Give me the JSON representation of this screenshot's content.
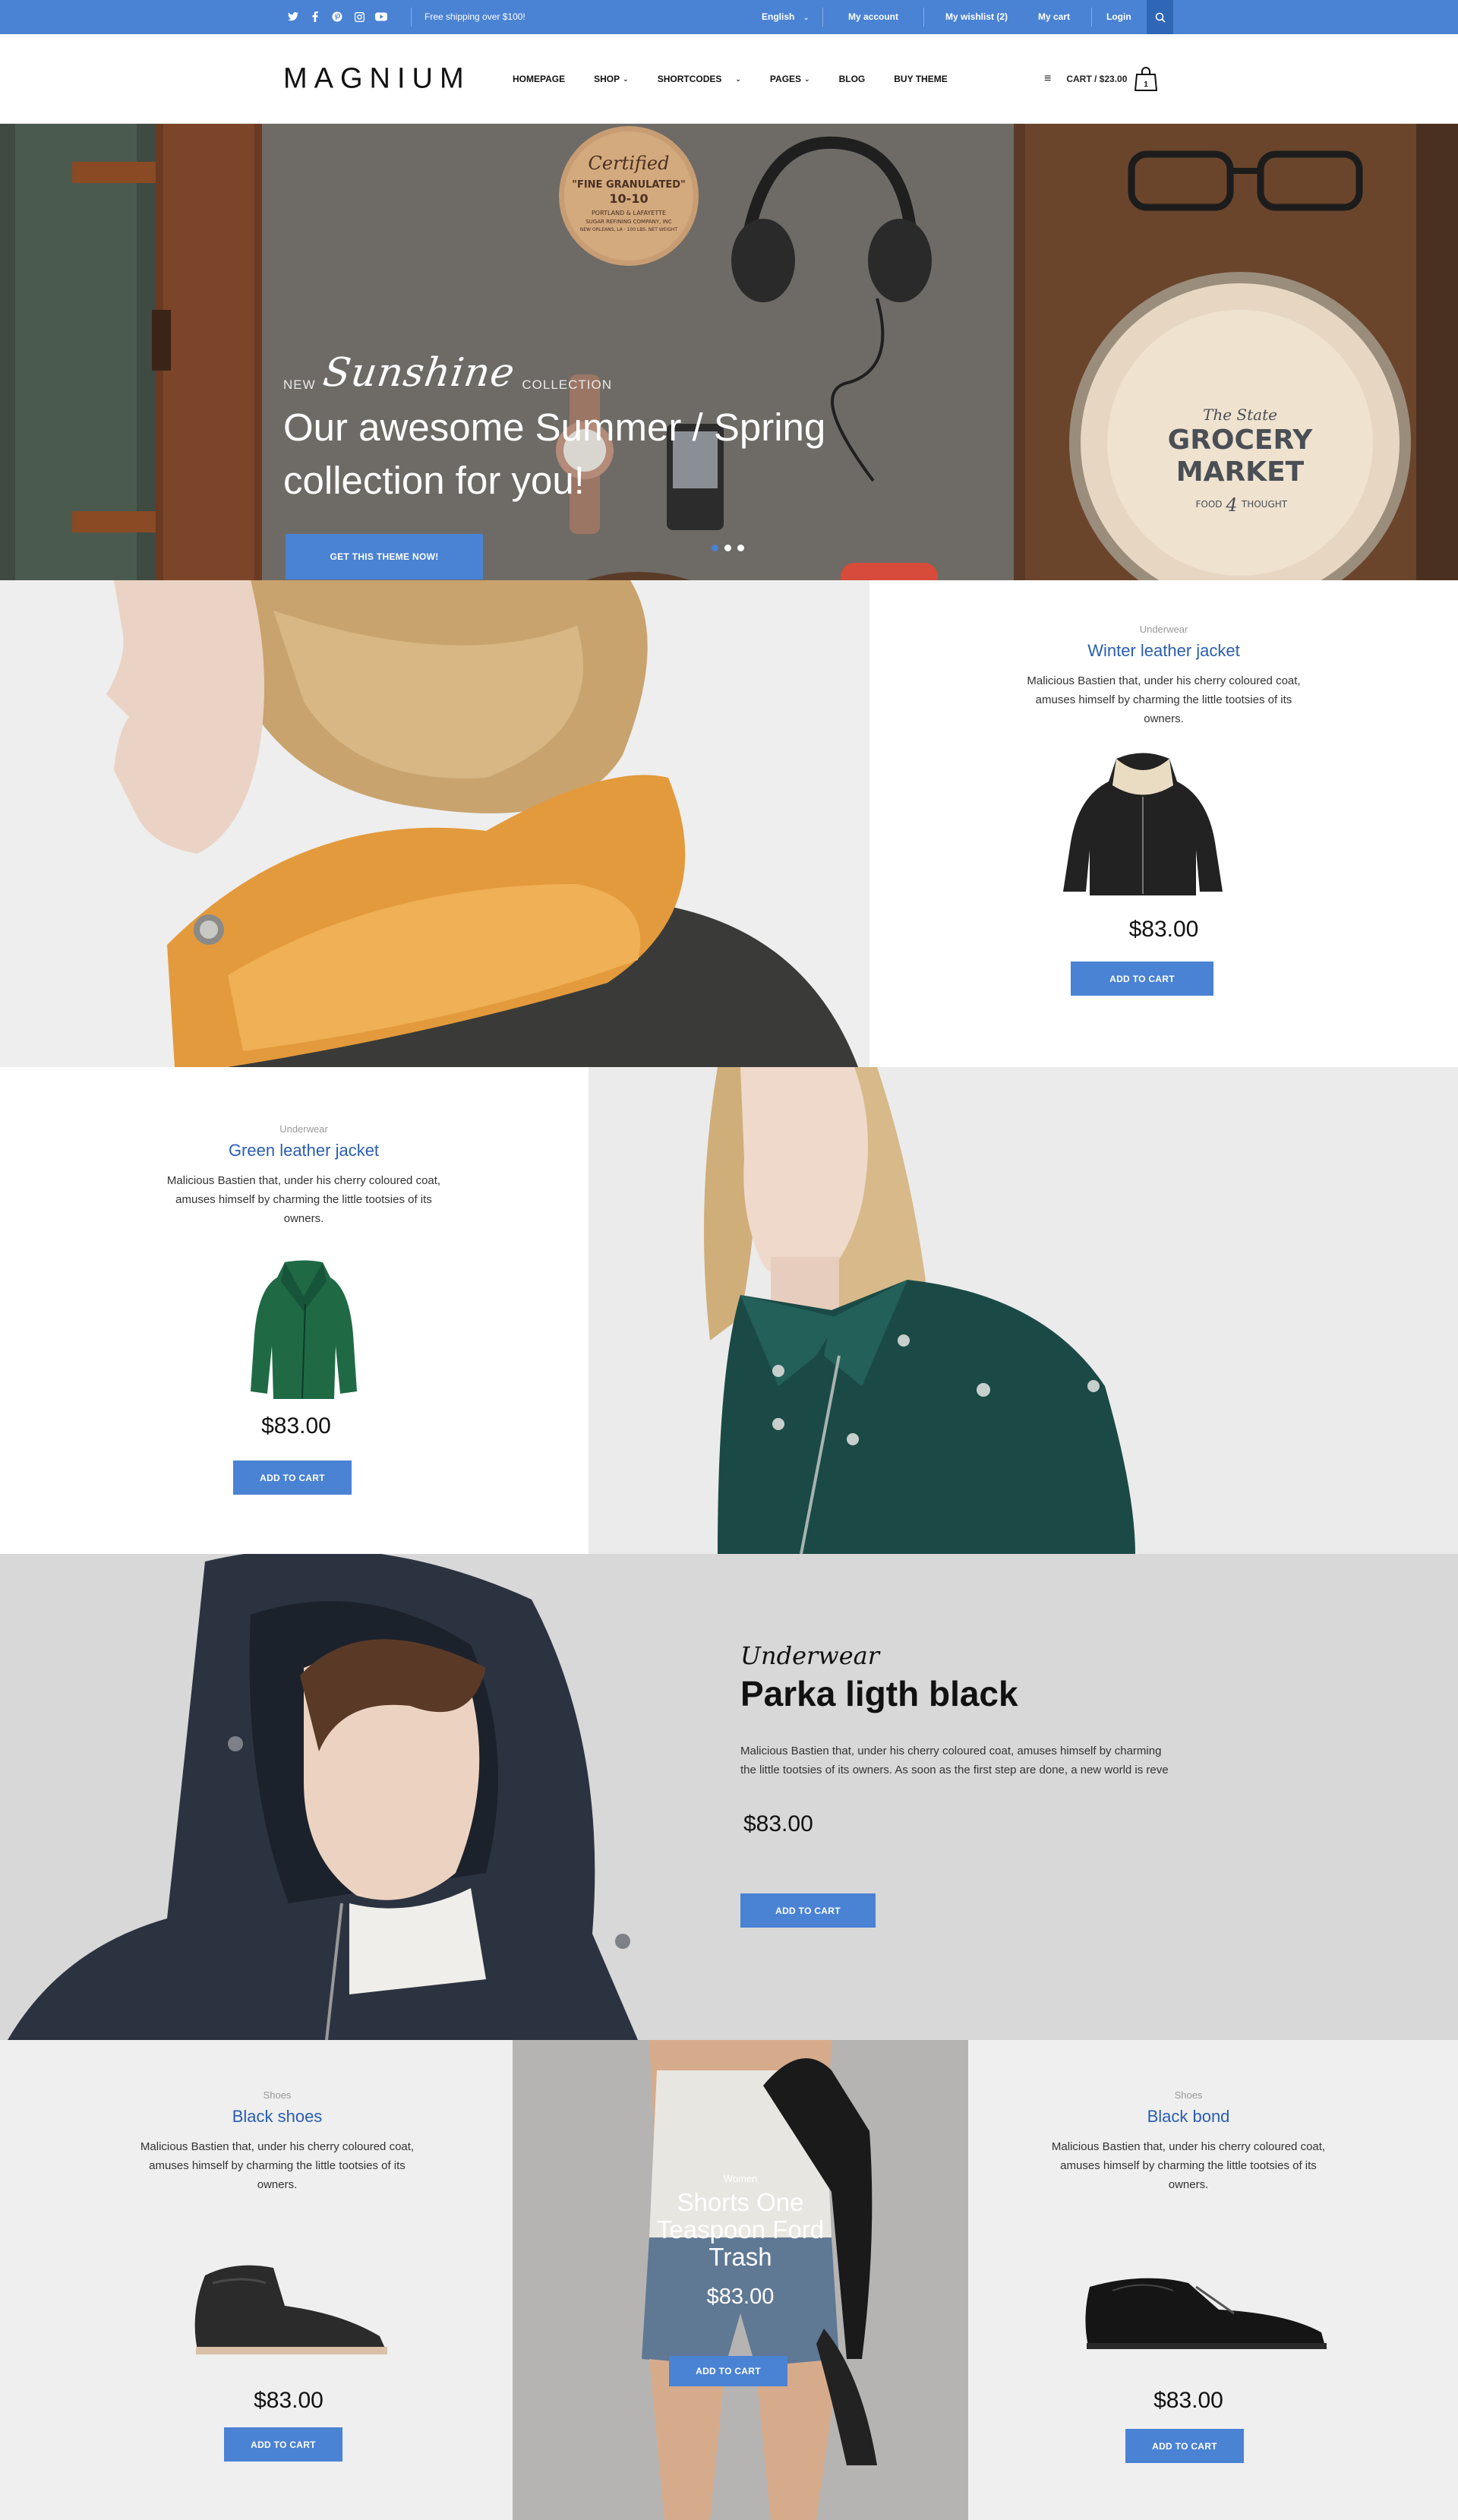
{
  "topbar": {
    "social": [
      "twitter-icon",
      "facebook-icon",
      "pinterest-icon",
      "instagram-icon",
      "youtube-icon"
    ],
    "shipping_text": "Free shipping over $100!",
    "language": "English",
    "my_account": "My account",
    "my_wishlist": "My wishlist (2)",
    "my_cart": "My cart",
    "login": "Login"
  },
  "header": {
    "logo": "MAGNIUM",
    "nav": [
      {
        "label": "HOMEPAGE",
        "dropdown": false
      },
      {
        "label": "SHOP",
        "dropdown": true
      },
      {
        "label": "SHORTCODES",
        "dropdown": true
      },
      {
        "label": "PAGES",
        "dropdown": true
      },
      {
        "label": "BLOG",
        "dropdown": false
      },
      {
        "label": "BUY THEME",
        "dropdown": false
      }
    ],
    "cart": "CART / $23.00",
    "cart_count": "1"
  },
  "hero": {
    "pre_new": "NEW",
    "script": "Sunshine",
    "pre_collection": "COLLECTION",
    "headline_line1": "Our awesome Summer / Spring",
    "headline_line2": "collection for you!",
    "cta": "GET THIS THEME NOW!",
    "slides": 3,
    "active_slide": 0,
    "props": {
      "coaster_line1": "Certified",
      "coaster_line2": "\"FINE GRANULATED\"",
      "coaster_line3": "10-10",
      "coaster_line4": "PORTLAND & LAFAYETTE",
      "coaster_line5": "SUGAR REFINING COMPANY, INC",
      "coaster_line6": "NEW ORLEANS, LA · 100 LBS. NET WEIGHT",
      "plate_line1": "The State",
      "plate_line2": "GROCERY",
      "plate_line3": "MARKET",
      "plate_line4": "FOOD",
      "plate_line5": "4",
      "plate_line6": "THOUGHT"
    }
  },
  "products": {
    "winter": {
      "category": "Underwear",
      "title": "Winter leather jacket",
      "desc": "Malicious Bastien that, under his cherry coloured coat, amuses himself by charming the little tootsies of its owners.",
      "price": "$83.00",
      "button": "ADD TO CART"
    },
    "green": {
      "category": "Underwear",
      "title": "Green leather jacket",
      "desc": "Malicious Bastien that, under his cherry coloured coat, amuses himself by charming the little tootsies of its owners.",
      "price": "$83.00",
      "button": "ADD TO CART"
    },
    "parka": {
      "category": "Underwear",
      "title": "Parka ligth black",
      "desc": "Malicious Bastien that, under his cherry coloured coat, amuses himself by charming the little tootsies of its owners. As soon as the first step are done, a new world is reve",
      "price": "$83.00",
      "button": "ADD TO CART"
    },
    "black_shoes": {
      "category": "Shoes",
      "title": "Black shoes",
      "desc": "Malicious Bastien that, under his cherry coloured coat, amuses himself by charming the little tootsies of its owners.",
      "price": "$83.00",
      "button": "ADD TO CART"
    },
    "shorts": {
      "category": "Women",
      "title": "Shorts One Teaspoon Ford Trash",
      "price": "$83.00",
      "button": "ADD TO CART"
    },
    "black_bond": {
      "category": "Shoes",
      "title": "Black bond",
      "desc": "Malicious Bastien that, under his cherry coloured coat, amuses himself by charming the little tootsies of its owners.",
      "price": "$83.00",
      "button": "ADD TO CART"
    }
  },
  "colors": {
    "accent": "#4a82d4",
    "title_blue": "#2a5db0"
  }
}
